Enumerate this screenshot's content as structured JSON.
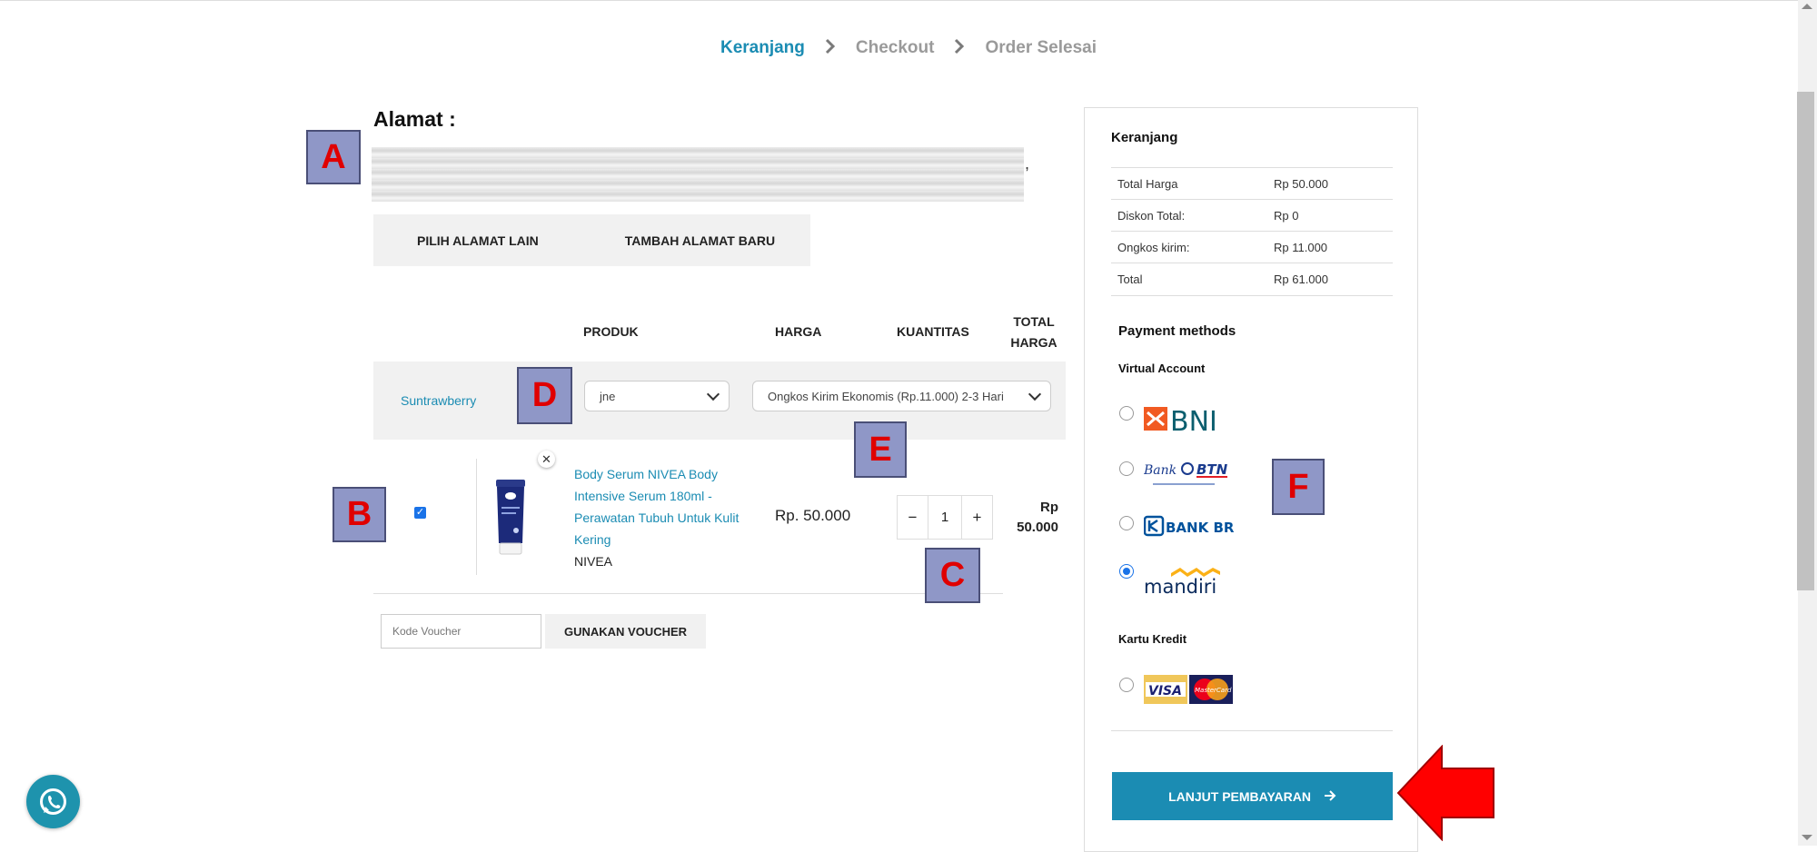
{
  "steps": {
    "step1": "Keranjang",
    "step2": "Checkout",
    "step3": "Order Selesai",
    "separator_icon": "chevron-right-icon"
  },
  "address": {
    "title": "Alamat :",
    "trailing": ",",
    "choose_other_label": "PILIH ALAMAT LAIN",
    "add_new_label": "TAMBAH ALAMAT BARU"
  },
  "table": {
    "headers": {
      "product": "PRODUK",
      "price": "HARGA",
      "quantity": "KUANTITAS",
      "total_line1": "TOTAL",
      "total_line2": "HARGA"
    }
  },
  "seller": {
    "name": "Suntrawberry",
    "courier": "jne",
    "shipping_option": "Ongkos Kirim Ekonomis (Rp.11.000) 2-3 Hari"
  },
  "product": {
    "selected": true,
    "name": "Body Serum NIVEA Body Intensive Serum 180ml - Perawatan Tubuh Untuk Kulit Kering",
    "brand": "NIVEA",
    "price": "Rp. 50.000",
    "quantity": "1",
    "minus": "−",
    "plus": "+",
    "total_line1": "Rp",
    "total_line2": "50.000",
    "remove_icon": "close-icon",
    "image_colors": {
      "tube": "#1c2a7a",
      "cap": "#ffffff",
      "logo": "#1b3a9e"
    }
  },
  "voucher": {
    "placeholder": "Kode Voucher",
    "button_label": "GUNAKAN VOUCHER"
  },
  "summary": {
    "title": "Keranjang",
    "rows": [
      {
        "label": "Total Harga",
        "value": "Rp 50.000"
      },
      {
        "label": "Diskon Total:",
        "value": "Rp 0"
      },
      {
        "label": "Ongkos kirim:",
        "value": "Rp 11.000"
      },
      {
        "label": "Total",
        "value": "Rp 61.000"
      }
    ]
  },
  "payment": {
    "title": "Payment methods",
    "virtual_account_title": "Virtual Account",
    "banks": [
      {
        "name": "BNI",
        "selected": false,
        "color": "#0b5e6e",
        "accent": "#f15a22"
      },
      {
        "name": "Bank BTN",
        "selected": false,
        "color": "#1a3b8e",
        "accent": "#e31e25"
      },
      {
        "name": "BANK BRI",
        "selected": false,
        "color": "#00529c"
      },
      {
        "name": "mandiri",
        "selected": true,
        "color": "#0a2a5c",
        "accent": "#fbb117"
      }
    ],
    "credit_card_title": "Kartu Kredit",
    "cards": [
      {
        "name": "VISA",
        "selected": false
      },
      {
        "name": "MasterCard",
        "selected": false
      }
    ],
    "continue_label": "LANJUT PEMBAYARAN",
    "continue_icon": "arrow-right-icon",
    "btn_color": "#1b8cb3"
  },
  "annotations": {
    "A": "A",
    "B": "B",
    "C": "C",
    "D": "D",
    "E": "E",
    "F": "F",
    "box_color": "#8f97c7",
    "letter_color": "#e00000",
    "arrow_color": "#e00000"
  },
  "whatsapp": {
    "icon": "whatsapp-icon",
    "color": "#1e93ad"
  }
}
